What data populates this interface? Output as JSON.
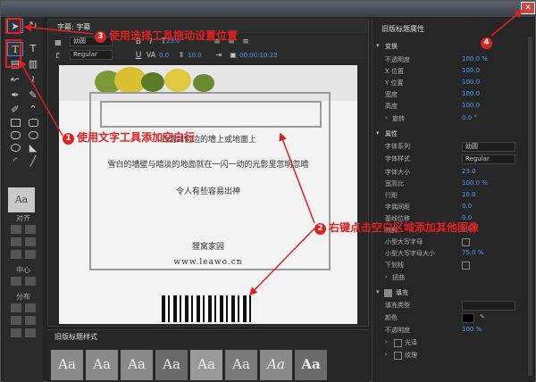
{
  "window": {
    "close_icon": "close-icon"
  },
  "center_panel": {
    "tab_title": "字幕: 字幕",
    "toolbar": {
      "font_family": "幼圆",
      "font_style": "Regular",
      "font_size": "23.0",
      "kerning": "0.0",
      "leading": "10.0",
      "timecode": "00:00:10:22"
    },
    "canvas": {
      "line1": "洒落到窗边的墙上或地面上",
      "line2": "雪白的墙壁与暗淡的地面就在一闪一动的光影里忽明忽暗",
      "line3": "令人有些容易出神",
      "line4": "狸窝家园",
      "line5": "www.leawo.cn"
    }
  },
  "styles_panel": {
    "title": "旧版标题样式",
    "swatches": [
      "Aa",
      "Aa",
      "Aa",
      "Aa",
      "Aa",
      "Aa",
      "Aa",
      "Aa"
    ]
  },
  "tools_panel": {
    "align_label": "对齐",
    "center_label": "中心",
    "distribute_label": "分布",
    "aa_label": "Aa"
  },
  "properties": {
    "title": "旧版标题属性",
    "transform_header": "变换",
    "rows_transform": [
      {
        "label": "不透明度",
        "value": "100.0 %"
      },
      {
        "label": "X 位置",
        "value": "100.0"
      },
      {
        "label": "Y 位置",
        "value": "100.0"
      },
      {
        "label": "宽度",
        "value": "100.0"
      },
      {
        "label": "高度",
        "value": "100.0"
      },
      {
        "label": "旋转",
        "value": "0.0 °"
      }
    ],
    "attr_header": "属性",
    "rows_attr": [
      {
        "label": "字体系列",
        "value": "幼圆"
      },
      {
        "label": "字体样式",
        "value": "Regular"
      },
      {
        "label": "字体大小",
        "value": "23.0"
      },
      {
        "label": "宽高比",
        "value": "100.0 %"
      },
      {
        "label": "行距",
        "value": "10.0"
      },
      {
        "label": "字偶间距",
        "value": "0.0"
      },
      {
        "label": "基线位移",
        "value": "0.0"
      },
      {
        "label": "倾斜",
        "value": "0.0 °"
      },
      {
        "label": "小型大写字母",
        "value": ""
      },
      {
        "label": "小型大写字母大小",
        "value": "75.0 %"
      },
      {
        "label": "下划线",
        "value": ""
      },
      {
        "label": "扭曲",
        "value": ""
      }
    ],
    "fill_header": "填充",
    "rows_fill": [
      {
        "label": "填充类型",
        "value": ""
      },
      {
        "label": "颜色",
        "value": ""
      },
      {
        "label": "不透明度",
        "value": "100 %"
      },
      {
        "label": "光泽",
        "value": ""
      },
      {
        "label": "纹理",
        "value": ""
      }
    ]
  },
  "annotations": {
    "a1_num": "1",
    "a1_text": "使用文字工具添加空白行",
    "a2_num": "2",
    "a2_text": "右键点击空白区域添加其他图像",
    "a3_num": "3",
    "a3_text": "使用选择工具拖动设置位置",
    "a4_num": "4"
  },
  "colors": {
    "accent": "#4ba0ff",
    "annotation": "#e02020"
  }
}
